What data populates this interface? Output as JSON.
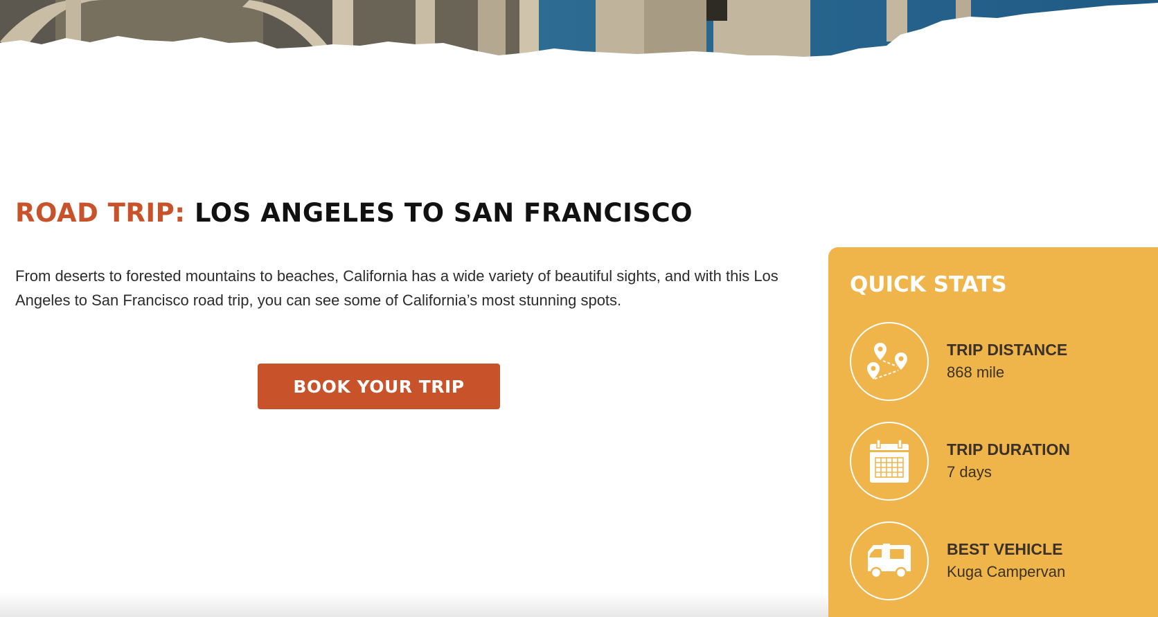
{
  "hero": {
    "image_name": "bridge-coastline-photo"
  },
  "title": {
    "prefix": "ROAD TRIP:",
    "main": "LOS ANGELES TO SAN FRANCISCO"
  },
  "intro_text": "From deserts to forested mountains to beaches, California has a wide variety of beautiful sights, and with this Los Angeles to San Francisco road trip, you can see some of California’s most stunning spots.",
  "cta": {
    "label": "BOOK YOUR TRIP"
  },
  "quick_stats": {
    "title": "QUICK STATS",
    "items": [
      {
        "icon": "map-pins-icon",
        "label": "TRIP DISTANCE",
        "value": "868 mile"
      },
      {
        "icon": "calendar-icon",
        "label": "TRIP DURATION",
        "value": "7 days"
      },
      {
        "icon": "campervan-icon",
        "label": "BEST VEHICLE",
        "value": "Kuga Campervan"
      }
    ]
  },
  "colors": {
    "accent": "#c8522a",
    "stats_panel": "#f0b54a",
    "heading": "#111111",
    "body_text": "#2b2b2b"
  }
}
